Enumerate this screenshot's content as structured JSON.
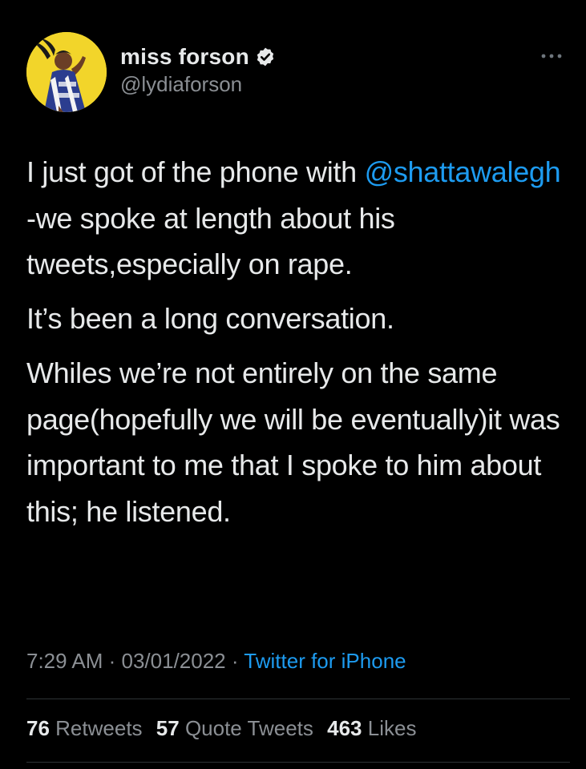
{
  "tweet": {
    "author": {
      "display_name": "miss forson",
      "handle": "@lydiaforson",
      "verified": true,
      "avatar": "avatar-photo"
    },
    "body": {
      "line1_text": "I just got of the phone with ",
      "mention": "@shattawalegh",
      "line1_rest": " -we spoke at length about his tweets,especially on rape.",
      "para2": "It’s been a long conversation.",
      "para3": "Whiles we’re not entirely on the same page(hopefully we will be eventually)it was important to me that I spoke to him about this; he listened."
    },
    "meta": {
      "time": "7:29 AM",
      "separator": " · ",
      "date": "03/01/2022",
      "source": "Twitter for iPhone"
    },
    "stats": {
      "retweets_count": "76",
      "retweets_label": "Retweets",
      "quote_count": "57",
      "quote_label": "Quote Tweets",
      "likes_count": "463",
      "likes_label": "Likes"
    }
  },
  "colors": {
    "background": "#000000",
    "text": "#e7e9ea",
    "secondary": "#8b8f94",
    "link": "#1d9bf0",
    "divider": "#2f3336",
    "avatar_bg": "#f2d52a"
  },
  "icons": [
    "verified-badge-icon",
    "more-options-icon"
  ]
}
